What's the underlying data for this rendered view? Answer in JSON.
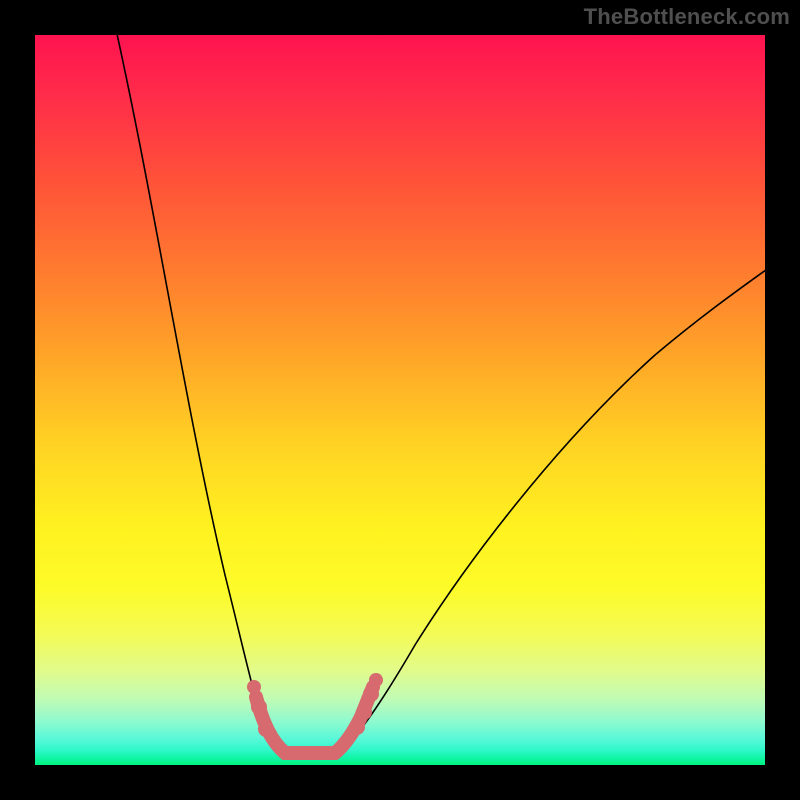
{
  "watermark": "TheBottleneck.com",
  "colors": {
    "frame": "#000000",
    "marker": "#d66a6e",
    "curve": "#000000",
    "gradient_top": "#ff1350",
    "gradient_bottom": "#00f47e"
  },
  "chart_data": {
    "type": "line",
    "title": "",
    "xlabel": "",
    "ylabel": "",
    "description": "Bottleneck-style V curve over a red-to-green vertical heat gradient. Lower y = better (green).",
    "x_range": [
      0,
      100
    ],
    "y_range": [
      0,
      100
    ],
    "y_orientation": "0 at bottom (green/good), 100 at top (red/bad)",
    "series": [
      {
        "name": "bottleneck-curve",
        "x": [
          11,
          14,
          18,
          22,
          26,
          29,
          31,
          33,
          35,
          38,
          41,
          45,
          52,
          62,
          75,
          88,
          100
        ],
        "y": [
          100,
          78,
          55,
          36,
          20,
          11,
          5,
          2,
          2,
          3,
          6,
          12,
          22,
          38,
          53,
          64,
          70
        ]
      }
    ],
    "highlighted_points": {
      "name": "optimal-range-markers",
      "comment": "coral dots near the valley floor",
      "x": [
        29,
        30,
        31,
        33,
        35,
        38,
        41,
        43,
        44,
        45,
        46,
        47
      ],
      "y": [
        11,
        8,
        5,
        2,
        2,
        2,
        2,
        4,
        6,
        8,
        10,
        12
      ]
    },
    "background": {
      "type": "vertical-gradient",
      "stops": [
        {
          "pos": 0.0,
          "color": "#ff1350"
        },
        {
          "pos": 0.2,
          "color": "#ff5239"
        },
        {
          "pos": 0.44,
          "color": "#ffa528"
        },
        {
          "pos": 0.68,
          "color": "#fff320"
        },
        {
          "pos": 0.88,
          "color": "#d4fb9a"
        },
        {
          "pos": 1.0,
          "color": "#00f47e"
        }
      ]
    }
  }
}
